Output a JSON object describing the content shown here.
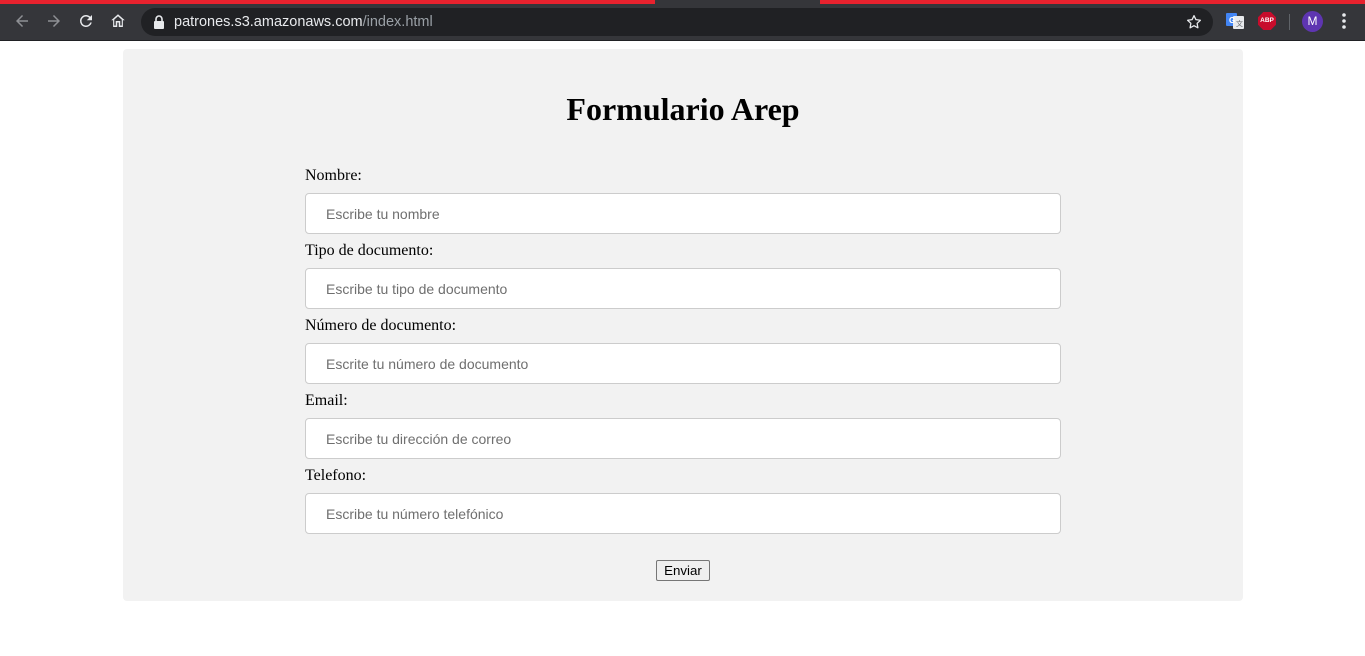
{
  "browser": {
    "url_host": "patrones.s3.amazonaws.com",
    "url_path": "/index.html",
    "profile_initial": "M",
    "accent_color": "#e8222e",
    "icons": [
      "back-icon",
      "forward-icon",
      "reload-icon",
      "home-icon",
      "lock-icon",
      "star-icon",
      "google-translate-icon",
      "adblock-plus-icon",
      "kebab-menu-icon"
    ],
    "extensions": {
      "abp_label": "ABP"
    }
  },
  "form": {
    "title": "Formulario Arep",
    "fields": [
      {
        "label": "Nombre:",
        "placeholder": "Escribe tu nombre",
        "value": ""
      },
      {
        "label": "Tipo de documento:",
        "placeholder": "Escribe tu tipo de documento",
        "value": ""
      },
      {
        "label": "Número de documento:",
        "placeholder": "Escrite tu número de documento",
        "value": ""
      },
      {
        "label": "Email:",
        "placeholder": "Escribe tu dirección de correo",
        "value": ""
      },
      {
        "label": "Telefono:",
        "placeholder": "Escribe tu número telefónico",
        "value": ""
      }
    ],
    "submit_label": "Enviar"
  }
}
